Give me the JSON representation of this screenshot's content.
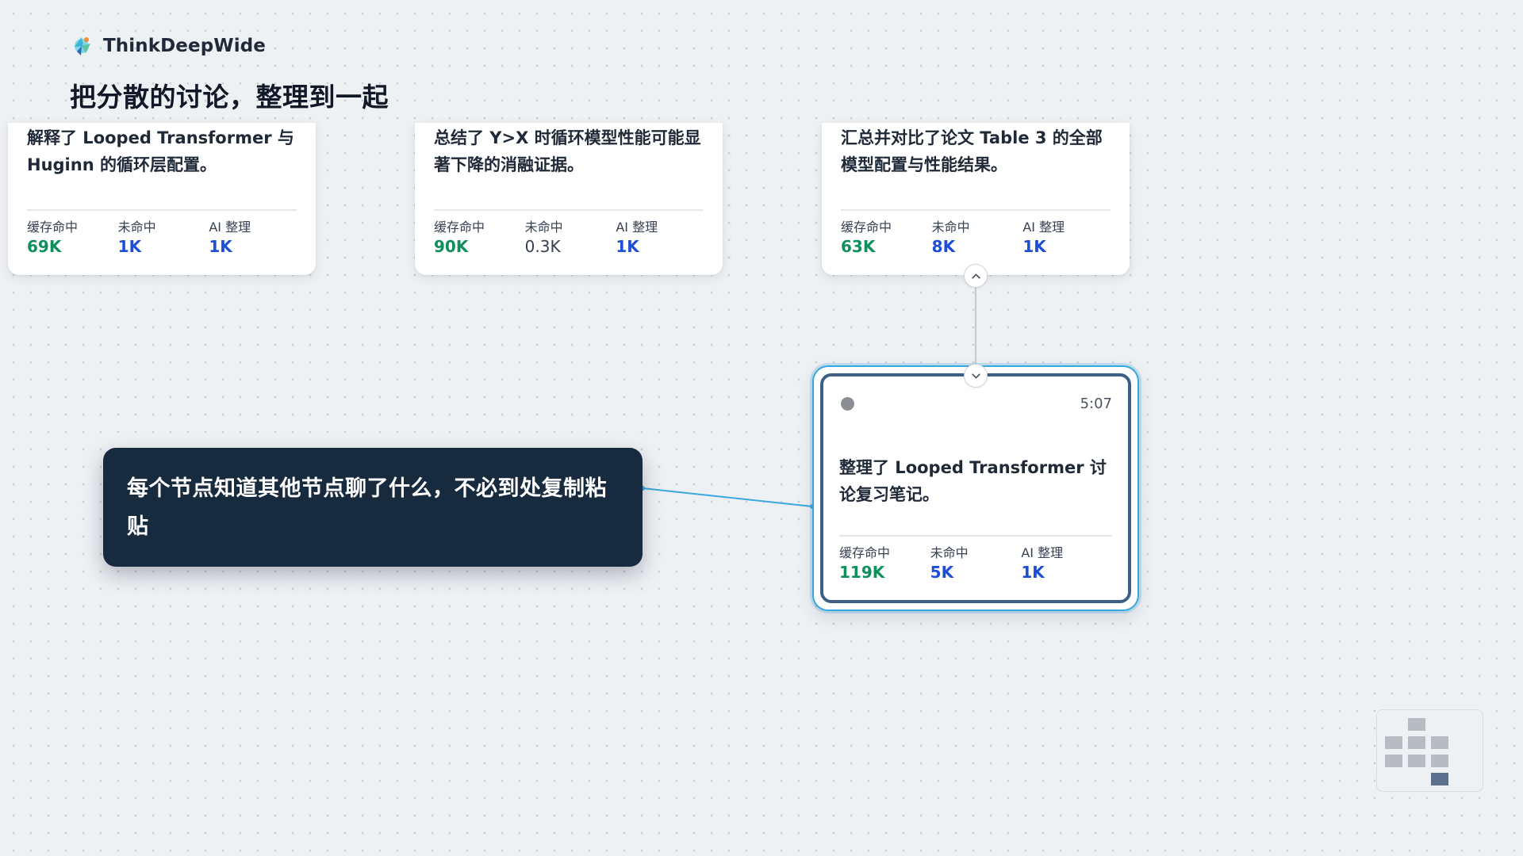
{
  "header": {
    "brand_name": "ThinkDeepWide",
    "title": "把分散的讨论，整理到一起"
  },
  "metric_labels": {
    "cache_hit": "缓存命中",
    "cache_miss": "未命中",
    "ai_organize": "AI 整理"
  },
  "cards": [
    {
      "text": "解释了 Looped Transformer 与 Huginn 的循环层配置。",
      "cache_hit": "69K",
      "cache_miss": "1K",
      "ai_organize": "1K"
    },
    {
      "text": "总结了 Y>X 时循环模型性能可能显著下降的消融证据。",
      "cache_hit": "90K",
      "cache_miss": "0.3K",
      "ai_organize": "1K"
    },
    {
      "text": "汇总并对比了论文 Table 3 的全部模型配置与性能结果。",
      "cache_hit": "63K",
      "cache_miss": "8K",
      "ai_organize": "1K"
    }
  ],
  "selected_node": {
    "time": "5:07",
    "text": "整理了 Looped Transformer 讨论复习笔记。",
    "cache_hit": "119K",
    "cache_miss": "5K",
    "ai_organize": "1K"
  },
  "callout": {
    "text": "每个节点知道其他节点聊了什么，不必到处复制粘贴"
  },
  "colors": {
    "cache_hit": "#0e8f5b",
    "metric_blue": "#1d4ed8",
    "callout_bg": "#172a3e",
    "selected_border": "#3aa6de",
    "connector": "#38a8de"
  },
  "icons": {
    "brand": "think-deep-wide-logo",
    "handle_top": "chevron-up-icon",
    "handle_bottom": "chevron-down-icon",
    "status": "status-dot-icon"
  }
}
